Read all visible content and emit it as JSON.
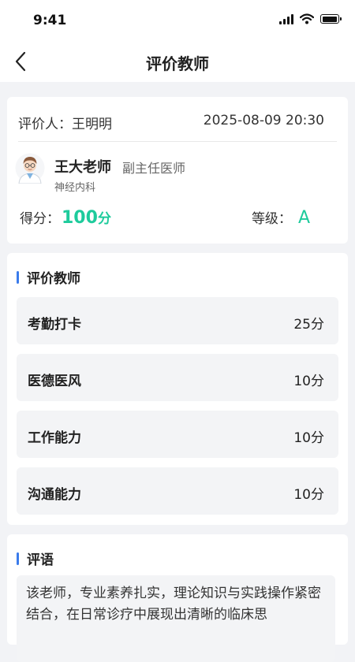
{
  "status": {
    "time": "9:41"
  },
  "nav": {
    "title": "评价教师"
  },
  "info": {
    "evaluator_label": "评价人：",
    "evaluator_name": "王明明",
    "datetime": "2025-08-09 20:30",
    "teacher_name": "王大老师",
    "teacher_title": "副主任医师",
    "department": "神经内科",
    "score_label": "得分：",
    "score_value": "100",
    "score_unit": "分",
    "grade_label": "等级：",
    "grade_value": "A"
  },
  "scores": {
    "title": "评价教师",
    "items": [
      {
        "label": "考勤打卡",
        "value": "25分"
      },
      {
        "label": "医德医风",
        "value": "10分"
      },
      {
        "label": "工作能力",
        "value": "10分"
      },
      {
        "label": "沟通能力",
        "value": "10分"
      }
    ]
  },
  "comment": {
    "title": "评语",
    "text": "该老师，专业素养扎实，理论知识与实践操作紧密结合，在日常诊疗中展现出清晰的临床思"
  },
  "colors": {
    "accent": "#1ECB9C",
    "section_bar": "#3A7BEB",
    "background": "#F2F3F6"
  }
}
